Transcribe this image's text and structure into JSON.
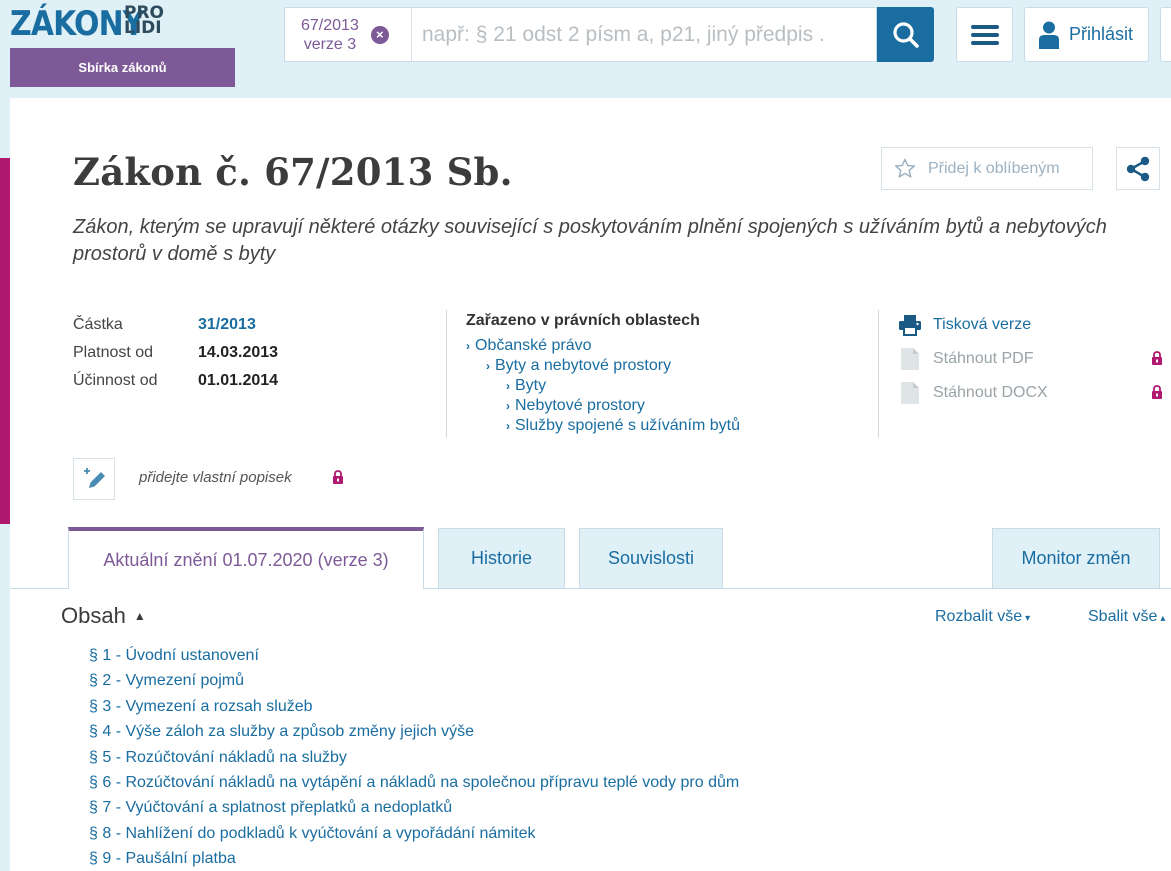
{
  "header": {
    "logo_main": "ZÁKONY",
    "logo_pro_1": "PRO",
    "logo_pro_2": "LIDI",
    "sbirka_label": "Sbírka zákonů",
    "search_chip_line1": "67/2013",
    "search_chip_line2": "verze 3",
    "search_placeholder": "např: § 21 odst 2 písm a, p21, jiný předpis .",
    "login_label": "Přihlásit"
  },
  "document": {
    "title": "Zákon č. 67/2013 Sb.",
    "subtitle": "Zákon, kterým se upravují některé otázky související s poskytováním plnění spojených s užíváním bytů a nebytových prostorů v domě s byty",
    "favorite_label": "Přidej k oblíbeným",
    "meta": [
      {
        "label": "Částka",
        "value": "31/2013",
        "link": true
      },
      {
        "label": "Platnost od",
        "value": "14.03.2013",
        "link": false
      },
      {
        "label": "Účinnost od",
        "value": "01.01.2014",
        "link": false
      }
    ],
    "areas_title": "Zařazeno v právních oblastech",
    "areas": [
      {
        "label": "Občanské právo",
        "level": 1
      },
      {
        "label": "Byty a nebytové prostory",
        "level": 2
      },
      {
        "label": "Byty",
        "level": 3
      },
      {
        "label": "Nebytové prostory",
        "level": 3
      },
      {
        "label": "Služby spojené s užíváním bytů",
        "level": 3
      }
    ],
    "actions": {
      "print_label": "Tisková verze",
      "pdf_label": "Stáhnout PDF",
      "docx_label": "Stáhnout DOCX"
    },
    "note_label": "přidejte vlastní popisek"
  },
  "tabs": {
    "active": "Aktuální znění 01.07.2020 (verze 3)",
    "historie": "Historie",
    "souvislosti": "Souvislosti",
    "monitor": "Monitor změn"
  },
  "contents": {
    "title": "Obsah",
    "expand_all": "Rozbalit vše",
    "collapse_all": "Sbalit vše",
    "items": [
      "§ 1 - Úvodní ustanovení",
      "§ 2 - Vymezení pojmů",
      "§ 3 - Vymezení a rozsah služeb",
      "§ 4 - Výše záloh za služby a způsob změny jejich výše",
      "§ 5 - Rozúčtování nákladů na služby",
      "§ 6 - Rozúčtování nákladů na vytápění a nákladů na společnou přípravu teplé vody pro dům",
      "§ 7 - Vyúčtování a splatnost přeplatků a nedoplatků",
      "§ 8 - Nahlížení do podkladů k vyúčtování a vypořádání námitek",
      "§ 9 - Paušální platba"
    ]
  },
  "colors": {
    "brand_blue": "#1a6da0",
    "brand_purple": "#7d5a97",
    "accent_magenta": "#b0196f",
    "header_bg": "#dff0f7"
  }
}
